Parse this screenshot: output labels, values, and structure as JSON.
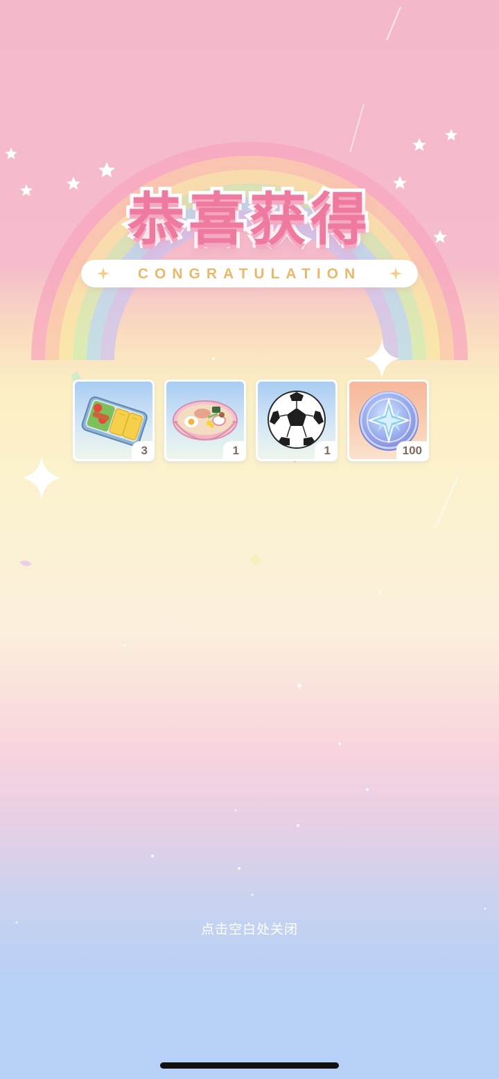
{
  "title": {
    "main": "恭喜获得",
    "banner": "CONGRATULATION"
  },
  "rewards": [
    {
      "name": "bento-box-icon",
      "quantity": "3"
    },
    {
      "name": "ramen-bowl-icon",
      "quantity": "1"
    },
    {
      "name": "soccer-ball-icon",
      "quantity": "1"
    },
    {
      "name": "star-coin-icon",
      "quantity": "100"
    }
  ],
  "close_hint": "点击空白处关闭",
  "colors": {
    "title_pink": "#ee7aa0",
    "banner_gold": "#e8b96a",
    "background_top": "#f4b8cb",
    "background_bottom": "#b6d0f7"
  }
}
